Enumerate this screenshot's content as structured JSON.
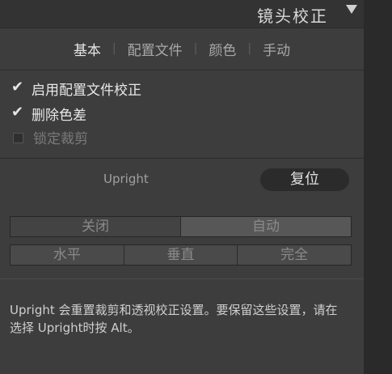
{
  "header": {
    "title": "镜头校正"
  },
  "tabs": [
    "基本",
    "配置文件",
    "颜色",
    "手动"
  ],
  "tab_sep": "|",
  "checkboxes": [
    {
      "label": "启用配置文件校正",
      "checked": true
    },
    {
      "label": "删除色差",
      "checked": true
    },
    {
      "label": "锁定裁剪",
      "checked": false
    }
  ],
  "upright": {
    "label": "Upright",
    "reset": "复位",
    "row1": [
      "关闭",
      "自动"
    ],
    "row2": [
      "水平",
      "垂直",
      "完全"
    ]
  },
  "footnote": "Upright 会重置裁剪和透视校正设置。要保留这些设置，请在选择 Upright时按 Alt。"
}
